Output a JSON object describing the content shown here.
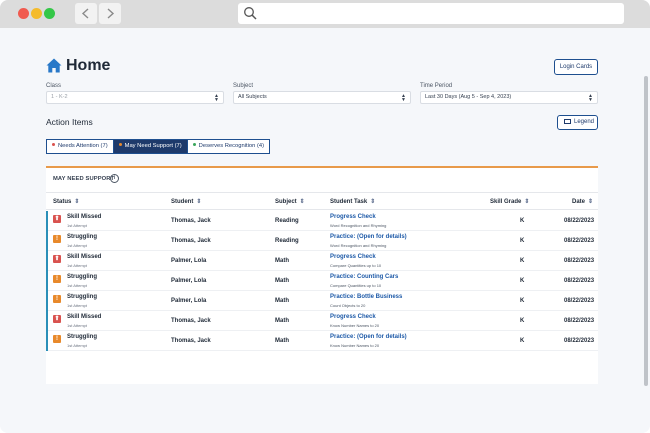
{
  "page": {
    "title": "Home",
    "login_cards": "Login Cards"
  },
  "filters": {
    "class_label": "Class",
    "class_value": "1 - K-2",
    "subject_label": "Subject",
    "subject_value": "All Subjects",
    "period_label": "Time Period",
    "period_value": "Last 30 Days (Aug 5 - Sep 4, 2023)"
  },
  "action_items": {
    "title": "Action Items",
    "legend_label": "Legend",
    "tabs": [
      {
        "label": "Needs Attention (7)",
        "dot_color": "#d9534f"
      },
      {
        "label": "May Need Support (7)",
        "dot_color": "#e8892b"
      },
      {
        "label": "Deserves Recognition (4)",
        "dot_color": "#3aa55b"
      }
    ]
  },
  "table": {
    "section_title": "MAY NEED SUPPORT",
    "columns": [
      "Status",
      "Student",
      "Subject",
      "Student Task",
      "Skill Grade",
      "Date"
    ],
    "rows": [
      {
        "status": "Skill Missed",
        "attempt": "1st Attempt",
        "status_color": "red",
        "student": "Thomas, Jack",
        "subject": "Reading",
        "task": "Progress Check",
        "task_sub": "Word Recognition and Rhyming",
        "grade": "K",
        "date": "08/22/2023"
      },
      {
        "status": "Struggling",
        "attempt": "1st Attempt",
        "status_color": "orange",
        "student": "Thomas, Jack",
        "subject": "Reading",
        "task": "Practice: (Open for details)",
        "task_sub": "Word Recognition and Rhyming",
        "grade": "K",
        "date": "08/22/2023"
      },
      {
        "status": "Skill Missed",
        "attempt": "1st Attempt",
        "status_color": "red",
        "student": "Palmer, Lola",
        "subject": "Math",
        "task": "Progress Check",
        "task_sub": "Compare Quantities up to 10",
        "grade": "K",
        "date": "08/22/2023"
      },
      {
        "status": "Struggling",
        "attempt": "1st Attempt",
        "status_color": "orange",
        "student": "Palmer, Lola",
        "subject": "Math",
        "task": "Practice: Counting Cars",
        "task_sub": "Compare Quantities up to 10",
        "grade": "K",
        "date": "08/22/2023"
      },
      {
        "status": "Struggling",
        "attempt": "1st Attempt",
        "status_color": "orange",
        "student": "Palmer, Lola",
        "subject": "Math",
        "task": "Practice: Bottle Business",
        "task_sub": "Count Objects to 20",
        "grade": "K",
        "date": "08/22/2023"
      },
      {
        "status": "Skill Missed",
        "attempt": "1st Attempt",
        "status_color": "red",
        "student": "Thomas, Jack",
        "subject": "Math",
        "task": "Progress Check",
        "task_sub": "Know Number Names to 20",
        "grade": "K",
        "date": "08/22/2023"
      },
      {
        "status": "Struggling",
        "attempt": "1st Attempt",
        "status_color": "orange",
        "student": "Thomas, Jack",
        "subject": "Math",
        "task": "Practice: (Open for details)",
        "task_sub": "Know Number Names to 20",
        "grade": "K",
        "date": "08/22/2023"
      }
    ]
  },
  "colors": {
    "accent": "#1e3a6b",
    "link": "#1e5aa8",
    "row_bar": "#2a8fb8",
    "card_top": "#e89a4a"
  }
}
